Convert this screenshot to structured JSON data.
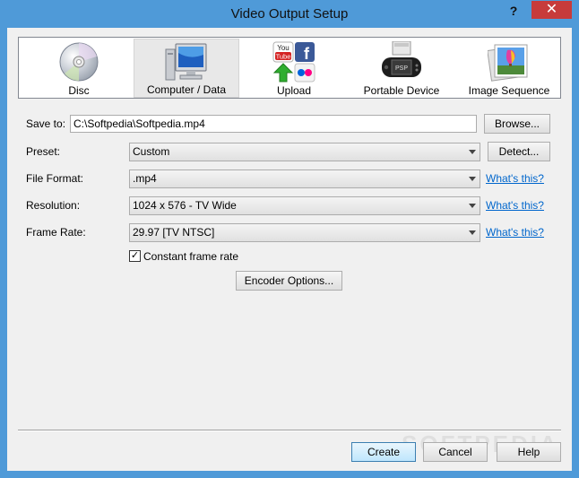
{
  "window": {
    "title": "Video Output Setup",
    "help_glyph": "?",
    "close_glyph": "✕"
  },
  "toolbar": {
    "items": [
      {
        "label": "Disc",
        "icon": "disc-icon"
      },
      {
        "label": "Computer / Data",
        "icon": "computer-icon",
        "active": true
      },
      {
        "label": "Upload",
        "icon": "upload-icon"
      },
      {
        "label": "Portable Device",
        "icon": "portable-device-icon"
      },
      {
        "label": "Image Sequence",
        "icon": "image-sequence-icon"
      }
    ],
    "psp_text": "PSP",
    "youtube_text": [
      "You",
      "Tube"
    ],
    "facebook_text": "f"
  },
  "form": {
    "save_to": {
      "label": "Save to:",
      "value": "C:\\Softpedia\\Softpedia.mp4",
      "browse": "Browse..."
    },
    "preset": {
      "label": "Preset:",
      "value": "Custom",
      "detect": "Detect..."
    },
    "file_format": {
      "label": "File Format:",
      "value": ".mp4",
      "link": "What's this?"
    },
    "resolution": {
      "label": "Resolution:",
      "value": "1024 x 576 - TV Wide",
      "link": "What's this?"
    },
    "frame_rate": {
      "label": "Frame Rate:",
      "value": "29.97 [TV NTSC]",
      "link": "What's this?"
    },
    "constant_frame_rate": {
      "label": "Constant frame rate",
      "checked": true,
      "mark": "✓"
    },
    "encoder_options": "Encoder Options..."
  },
  "footer": {
    "create": "Create",
    "cancel": "Cancel",
    "help": "Help",
    "watermark": "SOFTPEDIA"
  },
  "colors": {
    "titlebar": "#4f9ad8",
    "close": "#c73b3b",
    "link": "#0066cc"
  }
}
